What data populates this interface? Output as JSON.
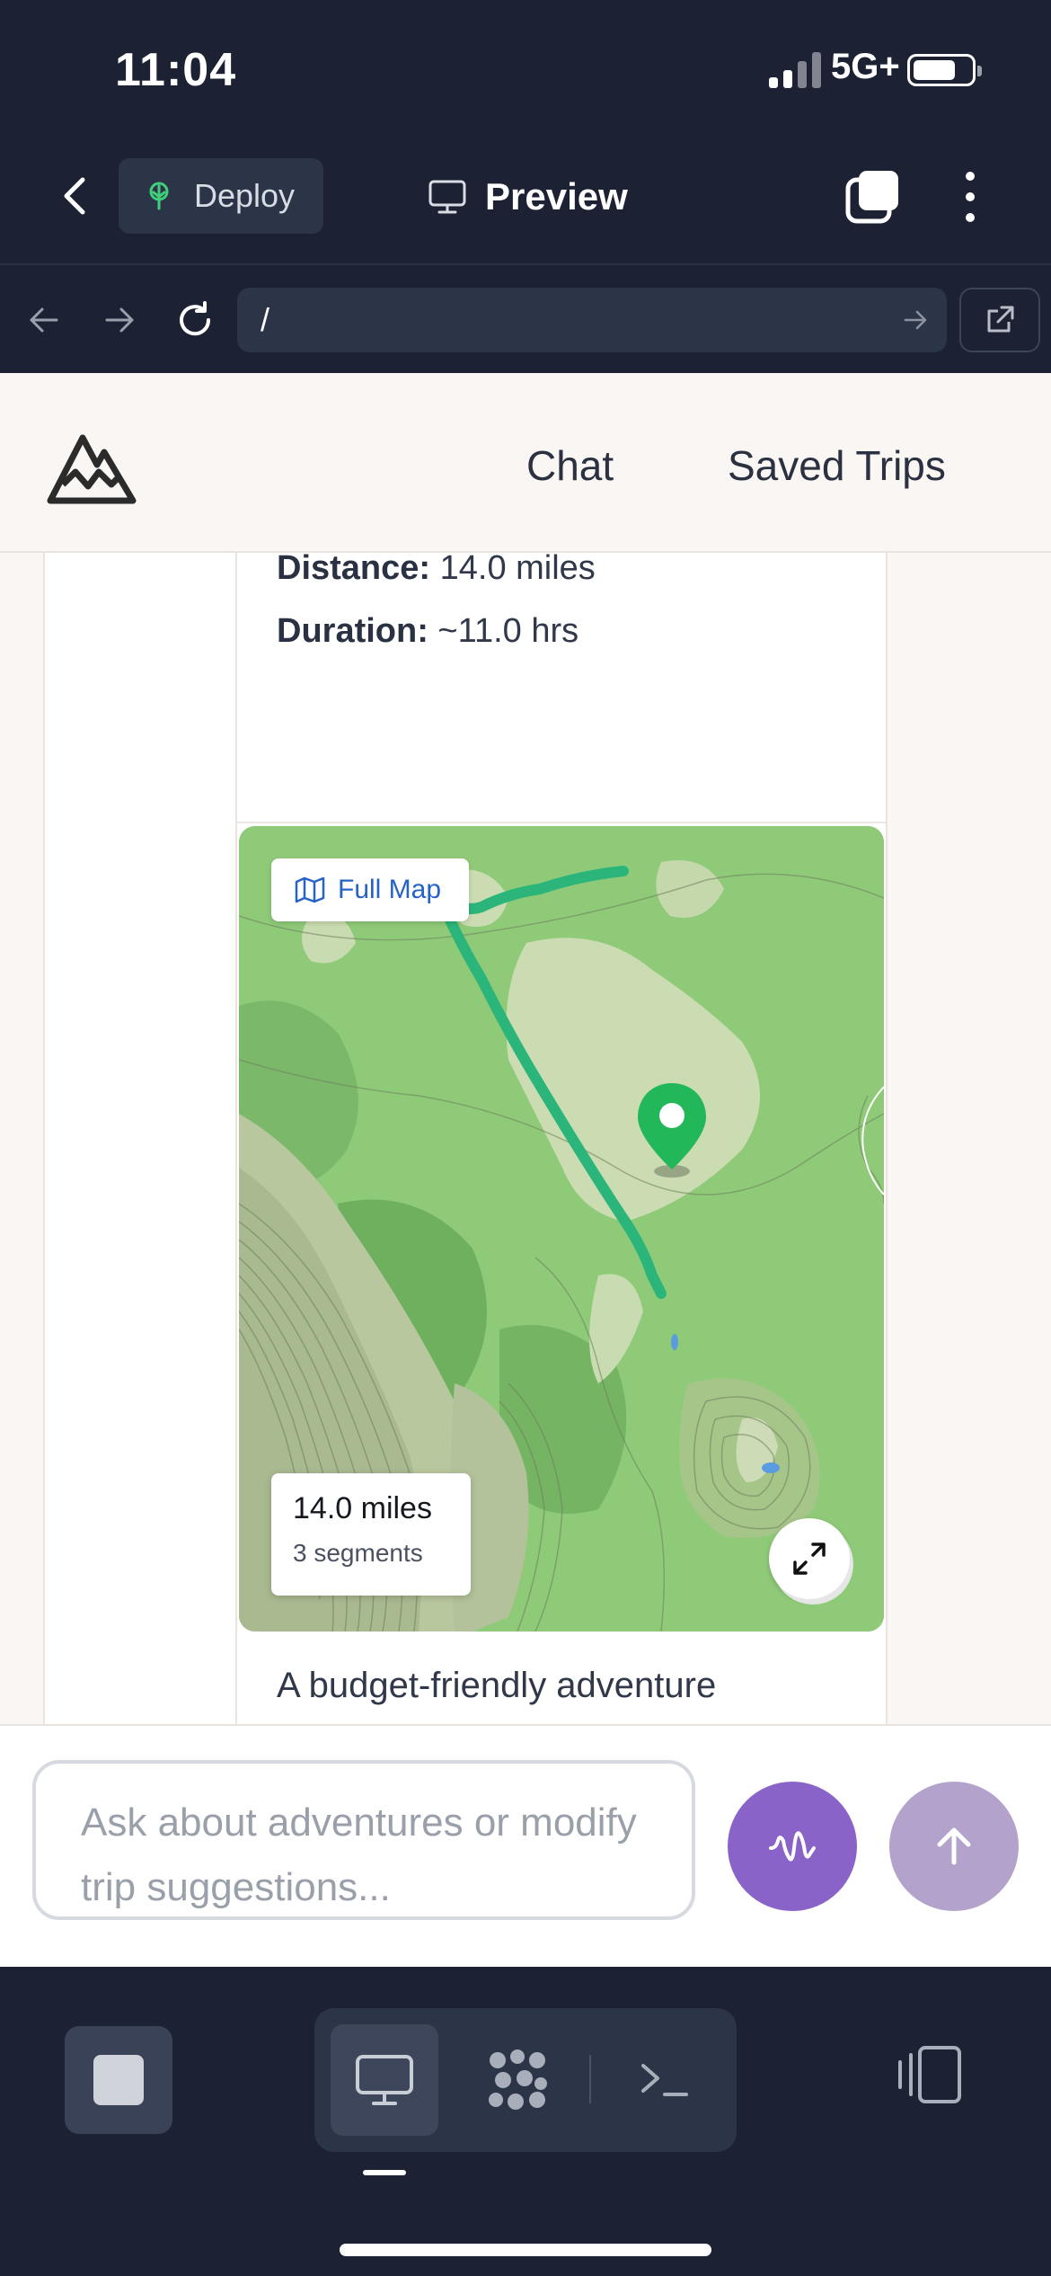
{
  "status_bar": {
    "time": "11:04",
    "network": "5G+"
  },
  "toolbar": {
    "deploy_label": "Deploy",
    "preview_label": "Preview"
  },
  "browser": {
    "url": "/"
  },
  "site": {
    "nav": {
      "chat": "Chat",
      "saved_trips": "Saved Trips"
    }
  },
  "trip": {
    "distance_label": "Distance:",
    "distance_value": " 14.0 miles",
    "duration_label": "Duration:",
    "duration_value": " ~11.0 hrs",
    "map": {
      "full_map_label": "Full Map",
      "total_distance": "14.0 miles",
      "segments": "3 segments",
      "route_color": "#2bb57a",
      "pin_color": "#22b85a"
    },
    "description": "A budget-friendly adventure exploring the serene Kendrick Mountain Wilderness near"
  },
  "composer": {
    "placeholder": "Ask about adventures or modify trip suggestions..."
  },
  "colors": {
    "chrome_bg": "#1c2233",
    "accent_purple": "#8a63c9",
    "send_disabled": "#b3a2cc",
    "page_bg": "#faf6f3"
  },
  "icons": [
    "back-icon",
    "tree-icon",
    "monitor-icon",
    "tabs-icon",
    "more-icon",
    "arrow-left-icon",
    "arrow-right-icon",
    "reload-icon",
    "external-link-icon",
    "map-icon",
    "map-pin-icon",
    "expand-icon",
    "waveform-icon",
    "arrow-up-icon",
    "stop-icon",
    "desktop-icon",
    "apps-icon",
    "terminal-icon",
    "side-panel-icon"
  ]
}
